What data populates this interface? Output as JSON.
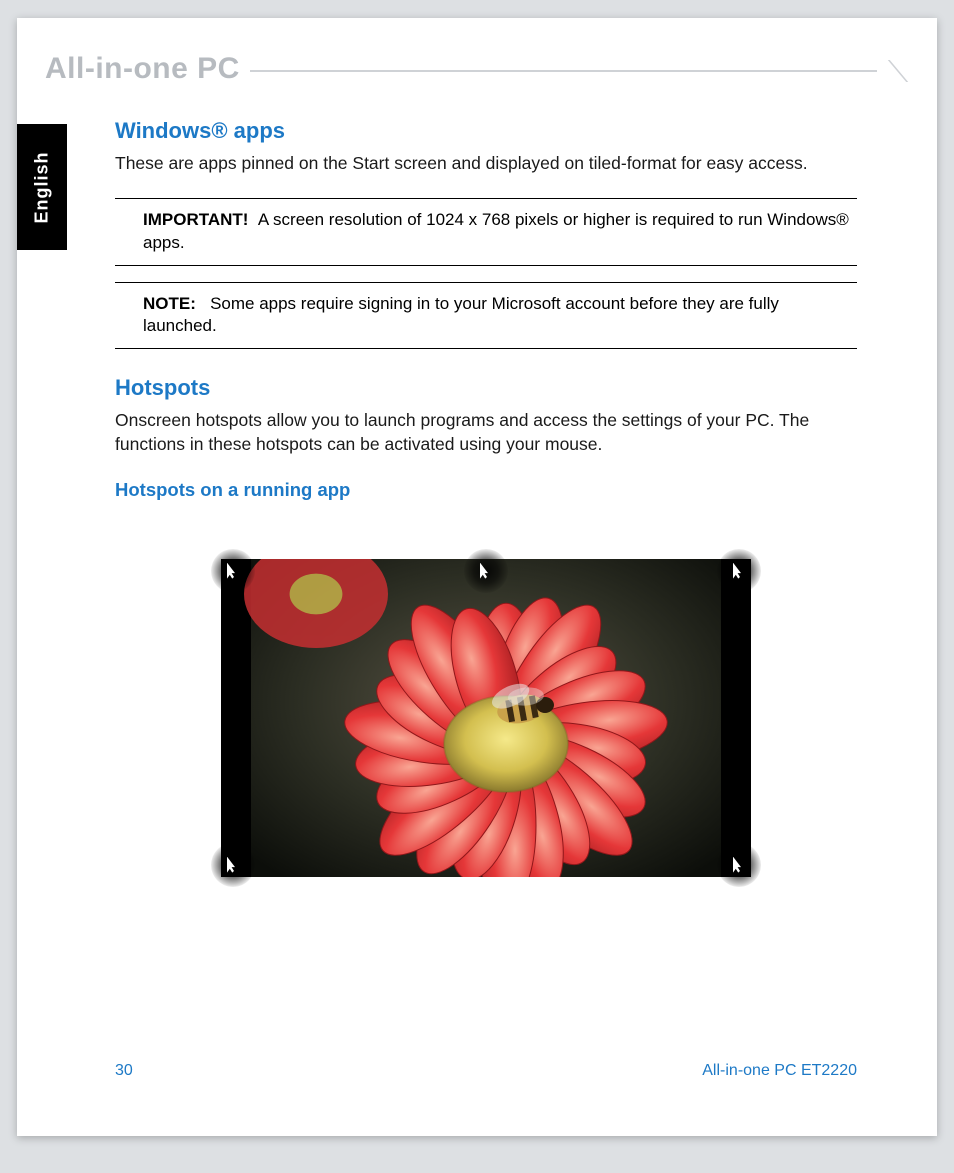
{
  "header": {
    "title": "All-in-one PC"
  },
  "sideTab": {
    "label": "English"
  },
  "section1": {
    "heading": "Windows® apps",
    "body": "These are apps pinned on the Start screen and displayed on tiled-format for easy access.",
    "important": {
      "label": "IMPORTANT!",
      "text": "A screen resolution of 1024 x 768 pixels or higher is required to run Windows® apps."
    },
    "note": {
      "label": "NOTE:",
      "text": "Some apps require signing in to your Microsoft account before they are fully launched."
    }
  },
  "section2": {
    "heading": "Hotspots",
    "body": "Onscreen hotspots allow you to launch programs and access the settings of your PC. The functions in these hotspots can be activated using your mouse.",
    "sub": "Hotspots on a running app"
  },
  "footer": {
    "pageNum": "30",
    "model": "All-in-one PC ET2220"
  }
}
